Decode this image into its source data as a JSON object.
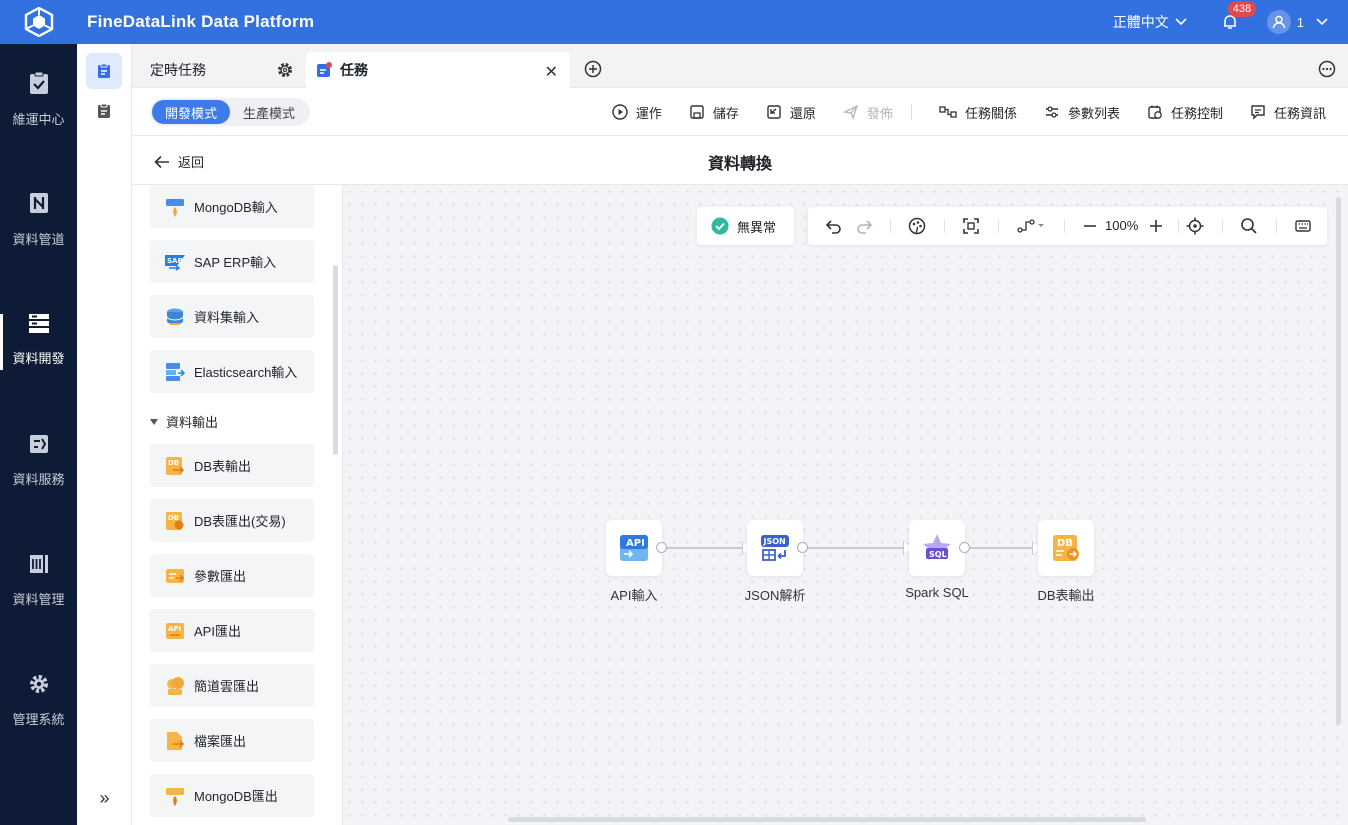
{
  "header": {
    "app_title": "FineDataLink Data Platform",
    "language": "正體中文",
    "notification_count": "438",
    "user_name": "1",
    "brand_color": "#3370e0"
  },
  "left_nav": {
    "items": [
      {
        "label": "維運中心",
        "icon": "clipboard-check-icon"
      },
      {
        "label": "資料管道",
        "icon": "pipeline-icon"
      },
      {
        "label": "資料開發",
        "icon": "data-dev-icon",
        "active": true
      },
      {
        "label": "資料服務",
        "icon": "data-service-icon"
      },
      {
        "label": "資料管理",
        "icon": "data-manage-icon"
      },
      {
        "label": "管理系統",
        "icon": "gear-icon"
      }
    ]
  },
  "tabs": [
    {
      "label": "定時任務"
    },
    {
      "label": "任務",
      "active": true
    }
  ],
  "toolbar": {
    "modes": [
      "開發模式",
      "生產模式"
    ],
    "active_mode": "開發模式",
    "actions": [
      {
        "label": "運作",
        "icon": "play-icon"
      },
      {
        "label": "儲存",
        "icon": "save-icon"
      },
      {
        "label": "還原",
        "icon": "restore-icon"
      },
      {
        "label": "發佈",
        "icon": "publish-icon",
        "disabled": true
      },
      {
        "label": "任務關係",
        "icon": "relation-icon"
      },
      {
        "label": "參數列表",
        "icon": "params-icon"
      },
      {
        "label": "任務控制",
        "icon": "control-icon"
      },
      {
        "label": "任務資訊",
        "icon": "info-icon"
      }
    ]
  },
  "page": {
    "back_label": "返回",
    "title": "資料轉換"
  },
  "component_panel": {
    "input_items": [
      {
        "label": "MongoDB輸入"
      },
      {
        "label": "SAP ERP輸入"
      },
      {
        "label": "資料集輸入"
      },
      {
        "label": "Elasticsearch輸入"
      }
    ],
    "output_section": "資料輸出",
    "output_items": [
      {
        "label": "DB表輸出"
      },
      {
        "label": "DB表匯出(交易)"
      },
      {
        "label": "參數匯出"
      },
      {
        "label": "API匯出"
      },
      {
        "label": "簡道雲匯出"
      },
      {
        "label": "檔案匯出"
      },
      {
        "label": "MongoDB匯出"
      }
    ]
  },
  "canvas": {
    "status": "無異常",
    "zoom": "100%",
    "nodes": [
      {
        "label": "API輸入",
        "badge": "API"
      },
      {
        "label": "JSON解析",
        "badge": "JSON"
      },
      {
        "label": "Spark SQL",
        "badge": "SQL"
      },
      {
        "label": "DB表輸出",
        "badge": "DB"
      }
    ]
  }
}
